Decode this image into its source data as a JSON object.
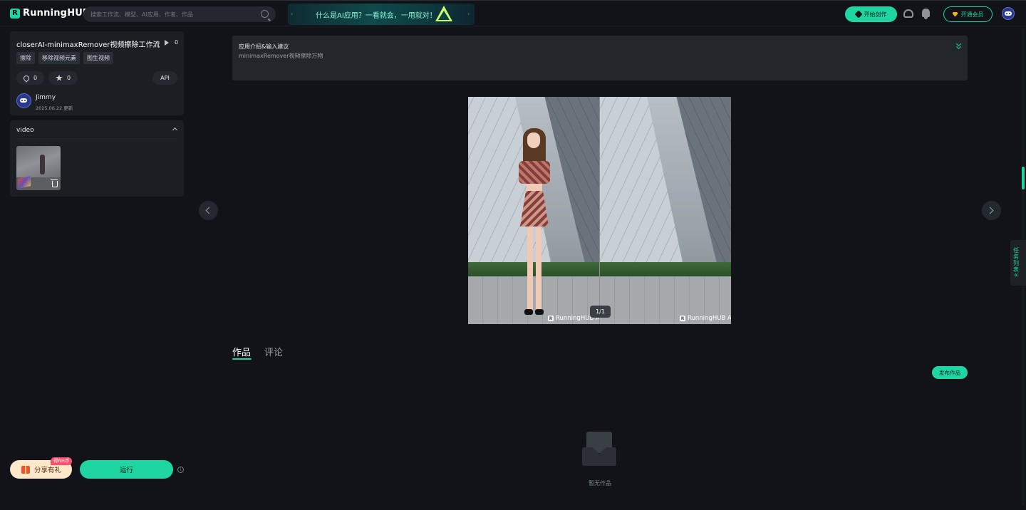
{
  "header": {
    "logo_mark": "R",
    "logo_text": "RunningHUB",
    "search_placeholder": "搜索工作流、模型、AI应用、作者、作品",
    "banner_text": "什么是AI应用？一看就会，一用就对！",
    "banner_prev": "‹",
    "banner_next": "›",
    "create_label": "开始创作",
    "vip_label": "开通会员"
  },
  "workflow": {
    "title": "closerAI-minimaxRemover视频擦除工作流",
    "play_count": "0",
    "tags": [
      "擦除",
      "移除视频元素",
      "图生视频"
    ],
    "likes": "0",
    "favorites": "0",
    "api_label": "API",
    "author_name": "Jimmy",
    "updated": "2025.06.22 更新"
  },
  "video_section": {
    "label": "video"
  },
  "actions": {
    "share_label": "分享有礼",
    "share_badge": "得RH币",
    "run_label": "运行",
    "info_glyph": "i"
  },
  "intro": {
    "title": "应用介绍&输入建议",
    "description": "minimaxRemover视频擦除万物"
  },
  "result": {
    "watermark": "RunningHUB AI",
    "watermark_mark": "R",
    "counter": "1/1"
  },
  "tabs": {
    "works": "作品",
    "comments": "评论"
  },
  "works": {
    "publish_label": "发布作品",
    "empty_text": "暂无作品"
  },
  "task_list": {
    "label": "任务列表",
    "chevron": "«"
  },
  "colors": {
    "accent": "#1fd6a2",
    "background": "#111318",
    "card": "#1b1e23"
  }
}
